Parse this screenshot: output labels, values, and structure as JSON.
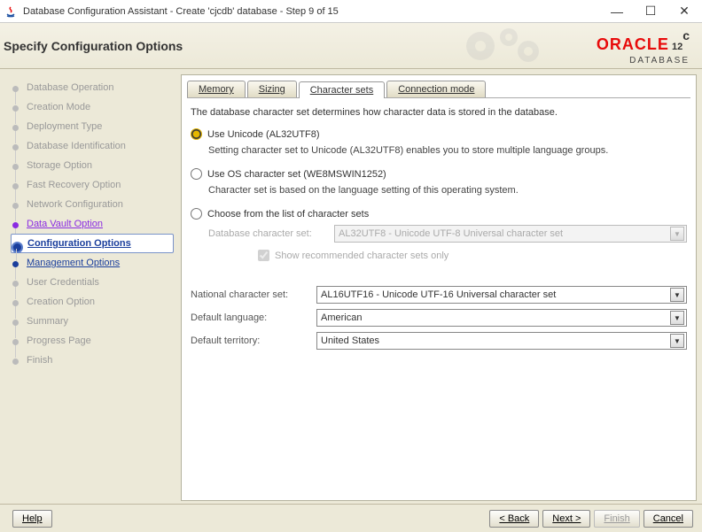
{
  "window": {
    "title": "Database Configuration Assistant - Create 'cjcdb' database - Step 9 of 15"
  },
  "header": {
    "title": "Specify Configuration Options",
    "brand_top": "ORACLE",
    "brand_bottom": "DATABASE",
    "version": "12",
    "version_suffix": "c"
  },
  "steps": [
    {
      "label": "Database Operation",
      "state": "past"
    },
    {
      "label": "Creation Mode",
      "state": "past"
    },
    {
      "label": "Deployment Type",
      "state": "past"
    },
    {
      "label": "Database Identification",
      "state": "past"
    },
    {
      "label": "Storage Option",
      "state": "past"
    },
    {
      "label": "Fast Recovery Option",
      "state": "past"
    },
    {
      "label": "Network Configuration",
      "state": "past"
    },
    {
      "label": "Data Vault Option",
      "state": "visited"
    },
    {
      "label": "Configuration Options",
      "state": "current"
    },
    {
      "label": "Management Options",
      "state": "next"
    },
    {
      "label": "User Credentials",
      "state": "future"
    },
    {
      "label": "Creation Option",
      "state": "future"
    },
    {
      "label": "Summary",
      "state": "future"
    },
    {
      "label": "Progress Page",
      "state": "future"
    },
    {
      "label": "Finish",
      "state": "future"
    }
  ],
  "tabs": {
    "memory": "Memory",
    "sizing": "Sizing",
    "charsets": "Character sets",
    "connection": "Connection mode"
  },
  "charset": {
    "intro": "The database character set determines how character data is stored in the database.",
    "opt_unicode": "Use Unicode (AL32UTF8)",
    "opt_unicode_desc": "Setting character set to Unicode (AL32UTF8) enables you to store multiple language groups.",
    "opt_os": "Use OS character set (WE8MSWIN1252)",
    "opt_os_desc": "Character set is based on the language setting of this operating system.",
    "opt_choose": "Choose from the list of character sets",
    "db_cs_label": "Database character set:",
    "db_cs_value": "AL32UTF8 - Unicode UTF-8 Universal character set",
    "show_recommended": "Show recommended character sets only",
    "nat_cs_label": "National character set:",
    "nat_cs_value": "AL16UTF16 - Unicode UTF-16 Universal character set",
    "def_lang_label": "Default language:",
    "def_lang_value": "American",
    "def_terr_label": "Default territory:",
    "def_terr_value": "United States"
  },
  "footer": {
    "help": "Help",
    "back": "< Back",
    "next": "Next >",
    "finish": "Finish",
    "cancel": "Cancel"
  }
}
